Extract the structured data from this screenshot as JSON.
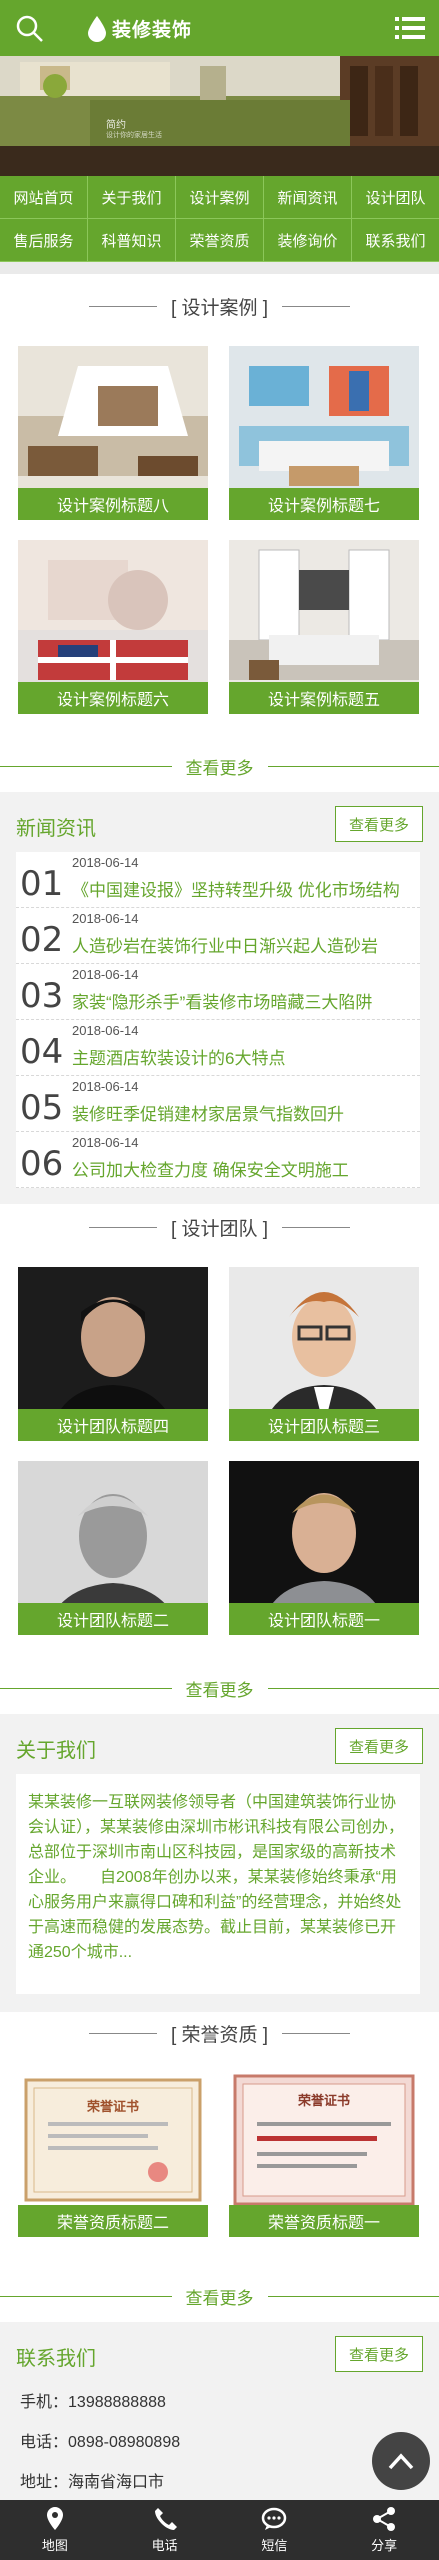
{
  "header": {
    "logo_text": "装修装饰",
    "search_icon": "search-icon",
    "menu_icon": "menu-icon"
  },
  "banner": {
    "caption": "简约",
    "subcaption": "设计你的家居生活"
  },
  "nav": {
    "items": [
      "网站首页",
      "关于我们",
      "设计案例",
      "新闻资讯",
      "设计团队",
      "售后服务",
      "科普知识",
      "荣誉资质",
      "装修询价",
      "联系我们"
    ]
  },
  "cases": {
    "title": "[ 设计案例 ]",
    "items": [
      "设计案例标题八",
      "设计案例标题七",
      "设计案例标题六",
      "设计案例标题五"
    ],
    "more": "查看更多"
  },
  "news": {
    "title": "新闻资讯",
    "more": "查看更多",
    "items": [
      {
        "num": "01",
        "date": "2018-06-14",
        "title": "《中国建设报》坚持转型升级 优化市场结构"
      },
      {
        "num": "02",
        "date": "2018-06-14",
        "title": "人造砂岩在装饰行业中日渐兴起人造砂岩"
      },
      {
        "num": "03",
        "date": "2018-06-14",
        "title": "家装“隐形杀手”看装修市场暗藏三大陷阱"
      },
      {
        "num": "04",
        "date": "2018-06-14",
        "title": "主题酒店软装设计的6大特点"
      },
      {
        "num": "05",
        "date": "2018-06-14",
        "title": "装修旺季促销建材家居景气指数回升"
      },
      {
        "num": "06",
        "date": "2018-06-14",
        "title": "公司加大检查力度 确保安全文明施工"
      }
    ]
  },
  "team": {
    "title": "[ 设计团队 ]",
    "items": [
      "设计团队标题四",
      "设计团队标题三",
      "设计团队标题二",
      "设计团队标题一"
    ],
    "more": "查看更多"
  },
  "about": {
    "title": "关于我们",
    "more": "查看更多",
    "text": "某某装修一互联网装修领导者（中国建筑装饰行业协会认证），某某装修由深圳市彬讯科技有限公司创办，总部位于深圳市南山区科技园，是国家级的高新技术企业。　　自2008年创办以来，某某装修始终秉承“用心服务用户来赢得口碑和利益”的经营理念，并始终处于高速而稳健的发展态势。截止目前，某某装修已开通250个城市..."
  },
  "honor": {
    "title": "[ 荣誉资质 ]",
    "items": [
      "荣誉资质标题二",
      "荣誉资质标题一"
    ],
    "cert_left": "荣誉证书",
    "cert_right": "荣誉证书",
    "more": "查看更多"
  },
  "contact": {
    "title": "联系我们",
    "more": "查看更多",
    "phone_label": "手机：",
    "phone": "13988888888",
    "tel_label": "电话：",
    "tel": "0898-08980898",
    "addr_label": "地址：",
    "addr": "海南省海口市"
  },
  "footer": {
    "items": [
      {
        "label": "地图",
        "icon": "map-pin-icon"
      },
      {
        "label": "电话",
        "icon": "phone-icon"
      },
      {
        "label": "短信",
        "icon": "message-icon"
      },
      {
        "label": "分享",
        "icon": "share-icon"
      }
    ]
  },
  "colors": {
    "brand": "#65a62d",
    "footer": "#2e2e2e"
  }
}
